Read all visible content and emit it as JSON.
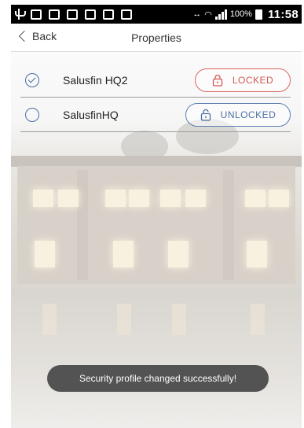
{
  "status_bar": {
    "battery_text": "100%",
    "clock": "11:58"
  },
  "nav": {
    "back_label": "Back",
    "title": "Properties"
  },
  "sites": [
    {
      "name": "Salusfin HQ2",
      "selected": true,
      "state_label": "LOCKED",
      "state": "locked"
    },
    {
      "name": "SalusfinHQ",
      "selected": false,
      "state_label": "UNLOCKED",
      "state": "unlocked"
    }
  ],
  "toast": {
    "message": "Security profile changed successfully!"
  },
  "colors": {
    "locked": "#d9675f",
    "unlocked": "#5b7fb2",
    "accent": "#4a6fa5"
  }
}
